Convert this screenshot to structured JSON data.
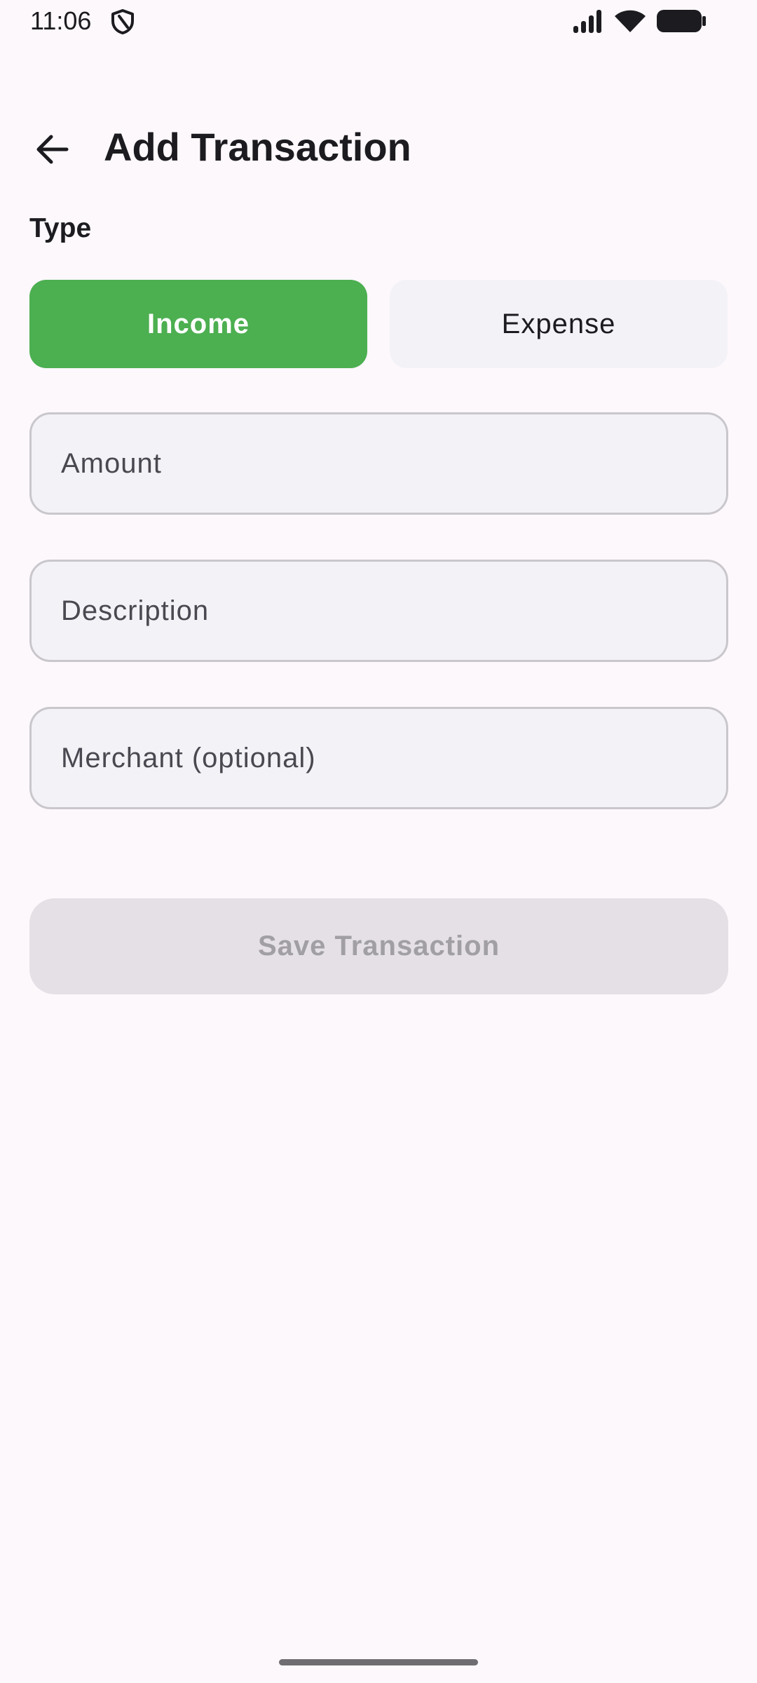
{
  "status_bar": {
    "time": "11:06",
    "icons": [
      "shield-icon",
      "signal-icon",
      "wifi-icon",
      "battery-icon"
    ]
  },
  "app_bar": {
    "back_icon": "arrow-back-icon",
    "title": "Add Transaction"
  },
  "form": {
    "type_label": "Type",
    "type_options": [
      {
        "label": "Income",
        "selected": true
      },
      {
        "label": "Expense",
        "selected": false
      }
    ],
    "fields": {
      "amount": {
        "placeholder": "Amount",
        "value": ""
      },
      "description": {
        "placeholder": "Description",
        "value": ""
      },
      "merchant": {
        "placeholder": "Merchant (optional)",
        "value": ""
      }
    },
    "save_label": "Save Transaction",
    "save_enabled": false
  },
  "colors": {
    "background": "#fdf8fc",
    "income_selected": "#4caf50",
    "segment_unselected": "#f3f2f6",
    "field_background": "#f3f2f6",
    "field_border": "#c9c7cc",
    "button_disabled": "#e4e0e5",
    "button_disabled_text": "#a19fa4"
  }
}
